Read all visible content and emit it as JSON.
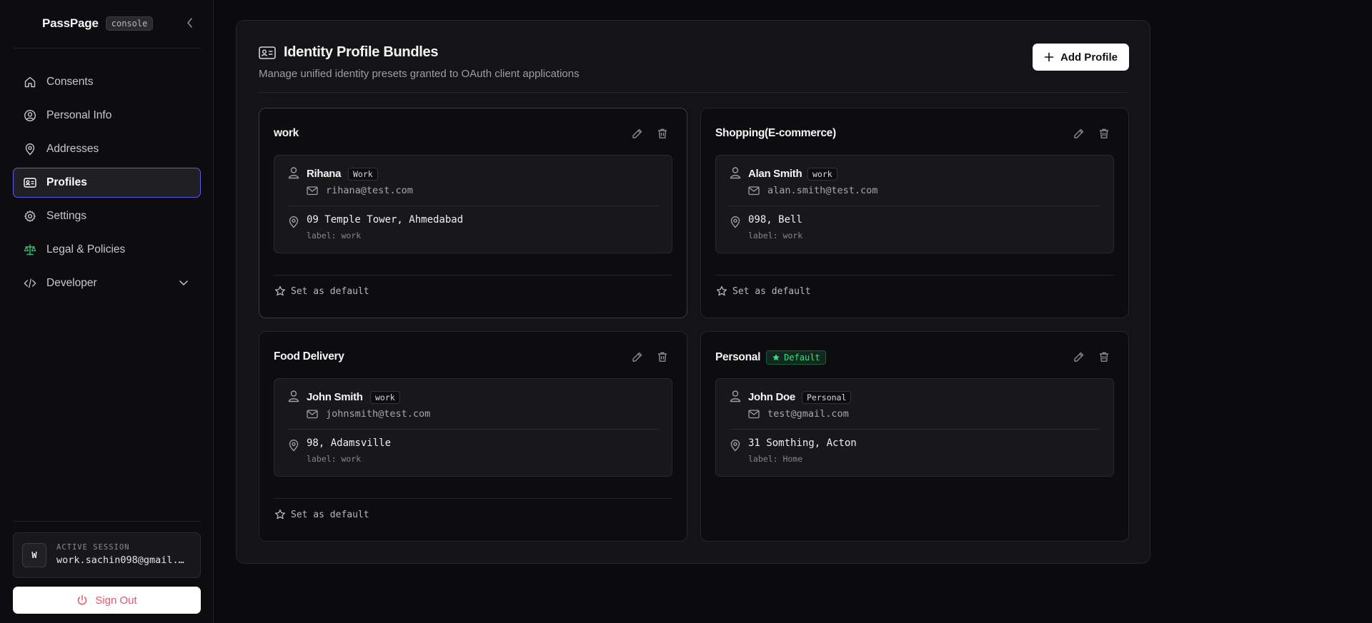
{
  "app": {
    "name": "PassPage",
    "badge": "console"
  },
  "sidebar": {
    "items": [
      {
        "label": "Consents",
        "icon": "home-icon"
      },
      {
        "label": "Personal Info",
        "icon": "user-circle-icon"
      },
      {
        "label": "Addresses",
        "icon": "map-pin-icon"
      },
      {
        "label": "Profiles",
        "icon": "id-card-icon",
        "active": true
      },
      {
        "label": "Settings",
        "icon": "gear-icon"
      },
      {
        "label": "Legal & Policies",
        "icon": "scale-icon"
      },
      {
        "label": "Developer",
        "icon": "code-icon",
        "expandable": true
      }
    ],
    "session": {
      "label": "ACTIVE SESSION",
      "avatar": "W",
      "email": "work.sachin098@gmail.…"
    },
    "sign_out_label": "Sign Out"
  },
  "main": {
    "title": "Identity Profile Bundles",
    "subtitle": "Manage unified identity presets granted to OAuth client applications",
    "add_button_label": "Add Profile",
    "profiles": [
      {
        "name": "work",
        "person": "Rihana",
        "tag": "Work",
        "email": "rihana@test.com",
        "address": "09 Temple Tower, Ahmedabad",
        "address_label": "label: work",
        "set_default_label": "Set as default"
      },
      {
        "name": "Shopping(E-commerce)",
        "person": "Alan Smith",
        "tag": "work",
        "email": "alan.smith@test.com",
        "address": "098, Bell",
        "address_label": "label: work",
        "set_default_label": "Set as default"
      },
      {
        "name": "Food Delivery",
        "person": "John Smith",
        "tag": "work",
        "email": "johnsmith@test.com",
        "address": "98, Adamsville",
        "address_label": "label: work",
        "set_default_label": "Set as default"
      },
      {
        "name": "Personal",
        "default_badge": "Default",
        "person": "John Doe",
        "tag": "Personal",
        "email": "test@gmail.com",
        "address": "31 Somthing, Acton",
        "address_label": "label: Home"
      }
    ]
  },
  "colors": {
    "accent": "#5b5ce6",
    "default_green": "#3ddc84",
    "signout_red": "#e8566b",
    "legal_icon_green": "#2fbf71"
  }
}
